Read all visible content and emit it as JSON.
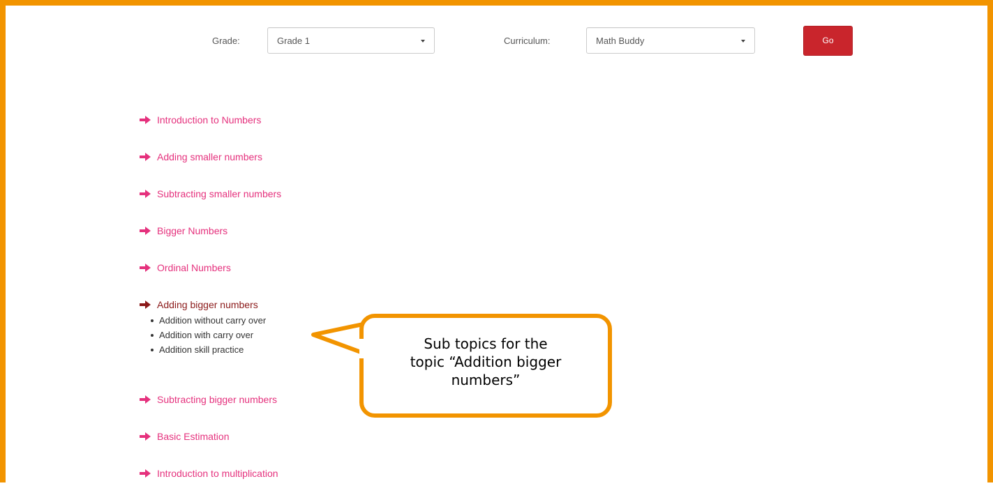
{
  "filters": {
    "grade_label": "Grade:",
    "grade_value": "Grade 1",
    "curriculum_label": "Curriculum:",
    "curriculum_value": "Math Buddy",
    "go_label": "Go"
  },
  "topics": [
    {
      "label": "Introduction to Numbers"
    },
    {
      "label": "Adding smaller numbers"
    },
    {
      "label": "Subtracting smaller numbers"
    },
    {
      "label": "Bigger Numbers"
    },
    {
      "label": "Ordinal Numbers"
    },
    {
      "label": "Adding bigger numbers",
      "subtopics": [
        "Addition without carry over",
        "Addition with carry over",
        "Addition skill practice"
      ]
    },
    {
      "label": "Subtracting bigger numbers"
    },
    {
      "label": "Basic Estimation"
    },
    {
      "label": "Introduction to multiplication"
    }
  ],
  "callout": {
    "line1": "Sub topics for the",
    "line2": "topic “Addition bigger",
    "line3": "numbers”"
  },
  "colors": {
    "frame": "#f29400",
    "topic_link": "#e5317d",
    "topic_active": "#8b1a1a",
    "go_button": "#c9252c"
  }
}
